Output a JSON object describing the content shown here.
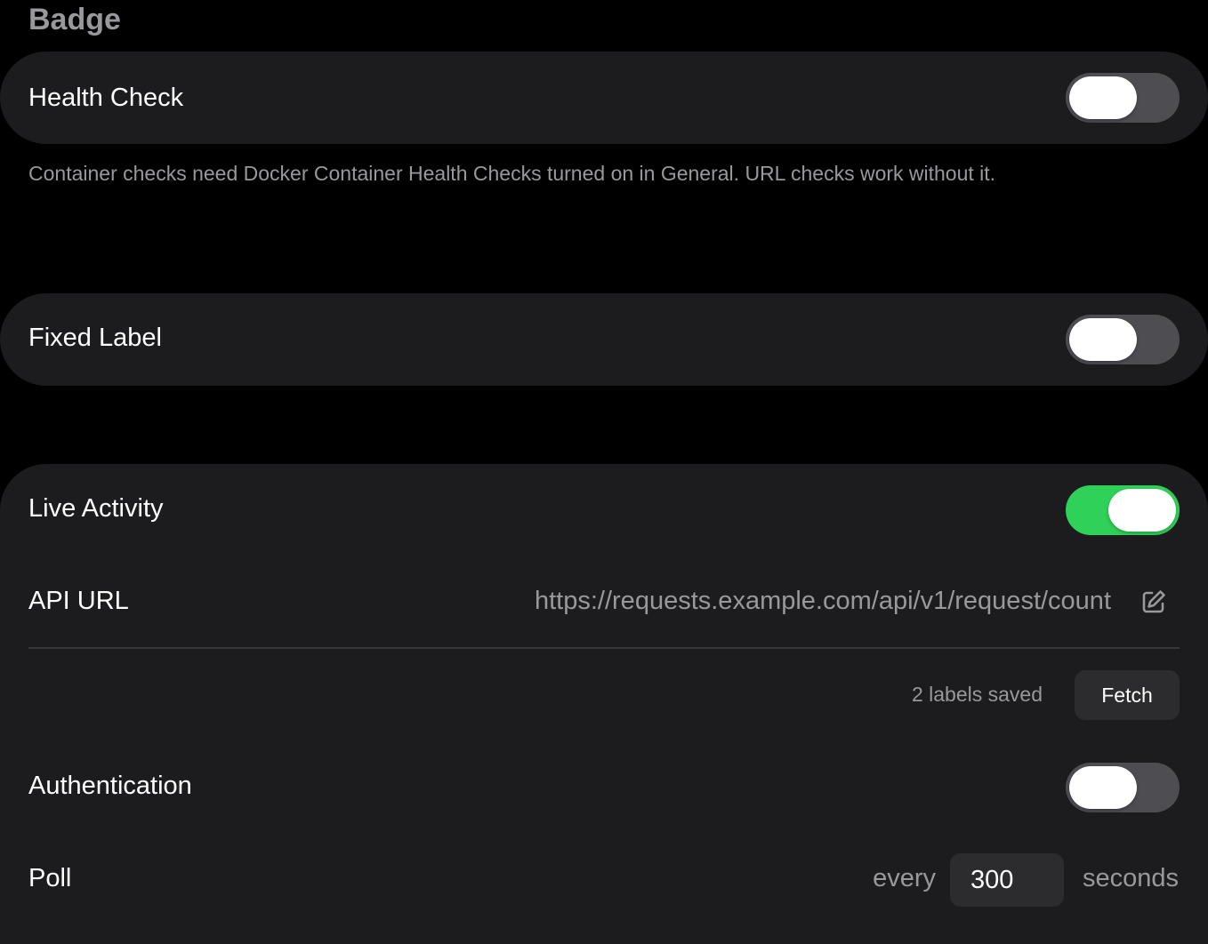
{
  "section_title": "Badge",
  "health_check": {
    "label": "Health Check",
    "enabled": false,
    "footnote": "Container checks need Docker Container Health Checks turned on in General. URL checks work without it."
  },
  "fixed_label": {
    "label": "Fixed Label",
    "enabled": false
  },
  "live_activity": {
    "label": "Live Activity",
    "enabled": true,
    "api_url": {
      "label": "API URL",
      "value": "https://requests.example.com/api/v1/request/count",
      "edit_icon": "edit-icon"
    },
    "labels_saved": "2 labels saved",
    "fetch_label": "Fetch",
    "authentication": {
      "label": "Authentication",
      "enabled": false
    },
    "poll": {
      "label": "Poll",
      "prefix": "every",
      "value": "300",
      "suffix": "seconds"
    }
  },
  "colors": {
    "background": "#000000",
    "card": "#1c1c1e",
    "toggle_on": "#30d158",
    "toggle_off": "#4d4d52",
    "secondary_text": "#98989d"
  }
}
